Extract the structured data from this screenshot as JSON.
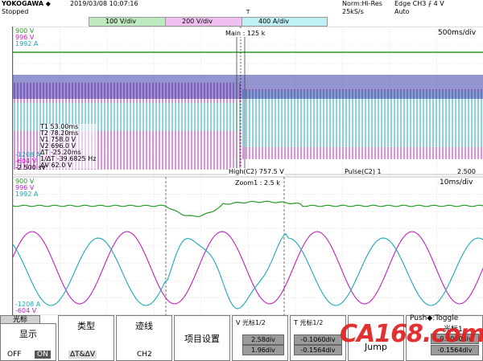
{
  "header": {
    "brand": "YOKOGAWA ◆",
    "state": "Stopped",
    "datetime": "2019/03/08  10:07:16",
    "mode": "Norm:Hi-Res",
    "rate": "25kS/s",
    "trigger": "Edge CH3  ⨏  4 V",
    "trigger_mode": "Auto",
    "ch_chips": [
      "100 V/div",
      "200 V/div",
      "400 A/div"
    ],
    "trig_mark": "T"
  },
  "main": {
    "ch_labels_top": [
      "900 V",
      "996 V",
      "1992 A"
    ],
    "ch_labels_bottom": [
      "-1208 A",
      "-604 V",
      "-2.500 sV"
    ],
    "main_label": "Main : 125 k",
    "timebase": "500ms/div",
    "cursors": [
      "T1   53.00ms",
      "T2   78.20ms",
      "V1   758.0 V",
      "V2   696.0 V",
      "ΔT   -25.20ms",
      "1/ΔT  -39.6825 Hz",
      "ΔV   62.0 V"
    ],
    "high_measure": "High(C2)    757.5 V",
    "pulse_measure": "Pulse(C2)    1",
    "pulse_value": "2.500"
  },
  "zoom": {
    "label": "Zoom1 : 2.5 k",
    "timebase": "10ms/div",
    "ch_labels_top": [
      "900 V",
      "996 V",
      "1992 A"
    ],
    "ch_labels_bottom": [
      "-1208 A",
      "-604 V"
    ]
  },
  "softkeys": {
    "cursor_tab": "光标",
    "display": {
      "title": "显示",
      "off": "OFF",
      "on": "ON"
    },
    "type": {
      "title": "类型",
      "value": "ΔT&ΔV"
    },
    "trace": {
      "title": "迹线",
      "value": "CH2"
    },
    "item_setting": "项目设置",
    "v_cursor": {
      "title": "V 光标1/2",
      "v1": "2.58div",
      "v2": "1.96div"
    },
    "t_cursor": {
      "title": "T 光标1/2",
      "t1": "-0.1060div",
      "t2": "-0.1564div"
    },
    "jump": "Jump",
    "toggle": {
      "title": "Push◆:Toggle",
      "label": "光标1",
      "v1": "-0.1060div",
      "v2": "-0.1564div"
    }
  },
  "watermark": "CA168.com",
  "colors": {
    "ch1": "#2a9a2a",
    "ch2": "#c020c0",
    "ch3": "#1aa8b8",
    "ch4": "#2a2aa0"
  }
}
